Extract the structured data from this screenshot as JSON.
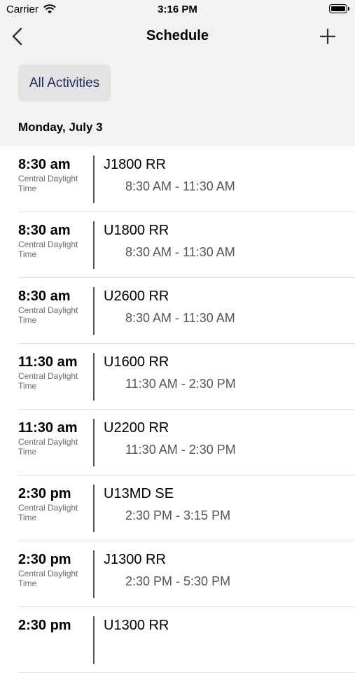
{
  "status_bar": {
    "carrier": "Carrier",
    "time": "3:16 PM"
  },
  "nav": {
    "title": "Schedule"
  },
  "filter": {
    "label": "All Activities"
  },
  "section": {
    "date": "Monday, July 3"
  },
  "events": [
    {
      "start": "8:30 am",
      "tz": "Central Daylight Time",
      "name": "J1800 RR",
      "range": "8:30 AM - 11:30 AM"
    },
    {
      "start": "8:30 am",
      "tz": "Central Daylight Time",
      "name": "U1800 RR",
      "range": "8:30 AM - 11:30 AM"
    },
    {
      "start": "8:30 am",
      "tz": "Central Daylight Time",
      "name": "U2600 RR",
      "range": "8:30 AM - 11:30 AM"
    },
    {
      "start": "11:30 am",
      "tz": "Central Daylight Time",
      "name": "U1600 RR",
      "range": "11:30 AM - 2:30 PM"
    },
    {
      "start": "11:30 am",
      "tz": "Central Daylight Time",
      "name": "U2200 RR",
      "range": "11:30 AM - 2:30 PM"
    },
    {
      "start": "2:30 pm",
      "tz": "Central Daylight Time",
      "name": "U13MD SE",
      "range": "2:30 PM - 3:15 PM"
    },
    {
      "start": "2:30 pm",
      "tz": "Central Daylight Time",
      "name": "J1300 RR",
      "range": "2:30 PM - 5:30 PM"
    },
    {
      "start": "2:30 pm",
      "tz": "",
      "name": "U1300 RR",
      "range": ""
    }
  ]
}
